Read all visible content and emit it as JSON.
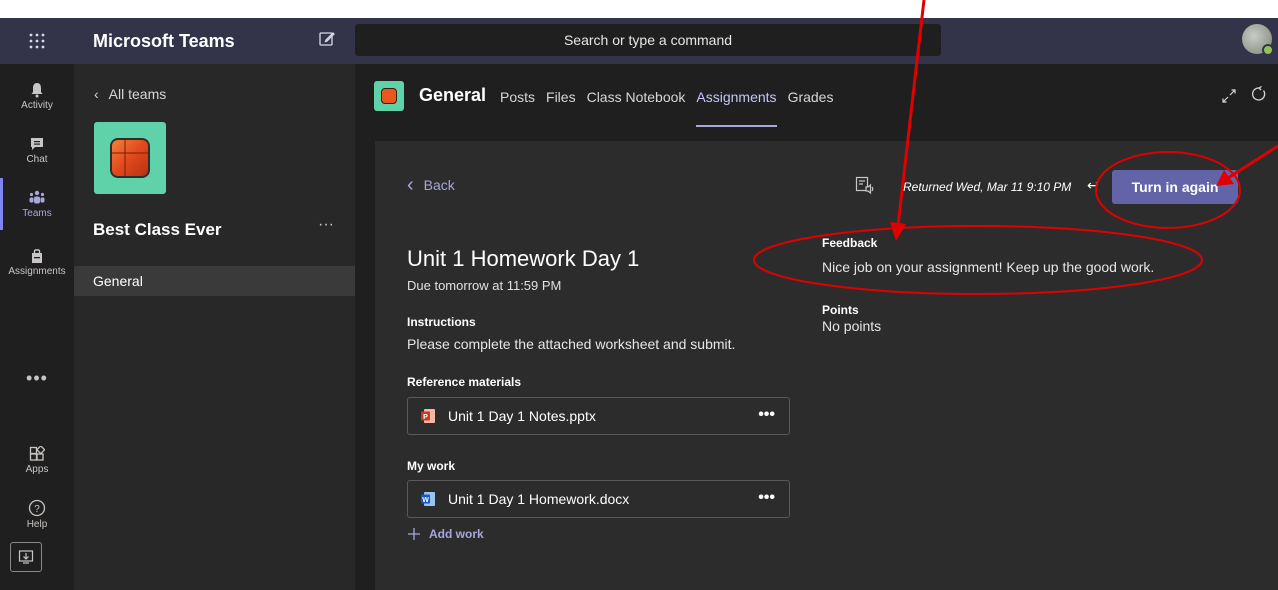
{
  "titlebar": {
    "app_name": "Microsoft Teams",
    "search_placeholder": "Search or type a command"
  },
  "rail": {
    "items": [
      {
        "label": "Activity",
        "icon": "bell-icon"
      },
      {
        "label": "Chat",
        "icon": "chat-icon"
      },
      {
        "label": "Teams",
        "icon": "teams-icon",
        "active": true
      },
      {
        "label": "Assignments",
        "icon": "assignments-icon"
      },
      {
        "label": "Apps",
        "icon": "apps-icon"
      },
      {
        "label": "Help",
        "icon": "help-icon"
      }
    ],
    "more": "•••"
  },
  "team_panel": {
    "back_label": "All teams",
    "team_name": "Best Class Ever",
    "more": "···",
    "channel": "General"
  },
  "channel_header": {
    "title": "General",
    "tabs": [
      "Posts",
      "Files",
      "Class Notebook",
      "Assignments",
      "Grades"
    ],
    "active_tab": "Assignments"
  },
  "assignment": {
    "back_label": "Back",
    "returned": "Returned Wed, Mar 11 9:10 PM",
    "turn_in_label": "Turn in again",
    "title": "Unit 1 Homework Day 1",
    "due": "Due tomorrow at 11:59 PM",
    "instructions_label": "Instructions",
    "instructions": "Please complete the attached worksheet and submit.",
    "reference_label": "Reference materials",
    "reference_file": "Unit 1 Day 1 Notes.pptx",
    "my_work_label": "My work",
    "my_work_file": "Unit 1 Day 1 Homework.docx",
    "add_work": "Add work",
    "file_more": "•••",
    "feedback_label": "Feedback",
    "feedback": "Nice job on your assignment! Keep up the good work.",
    "points_label": "Points",
    "points": "No points"
  },
  "colors": {
    "titlebar": "#33344a",
    "rail": "#201f1f",
    "accent": "#6264a7",
    "annotation": "#e00000",
    "tile": "#5fd2a9"
  }
}
